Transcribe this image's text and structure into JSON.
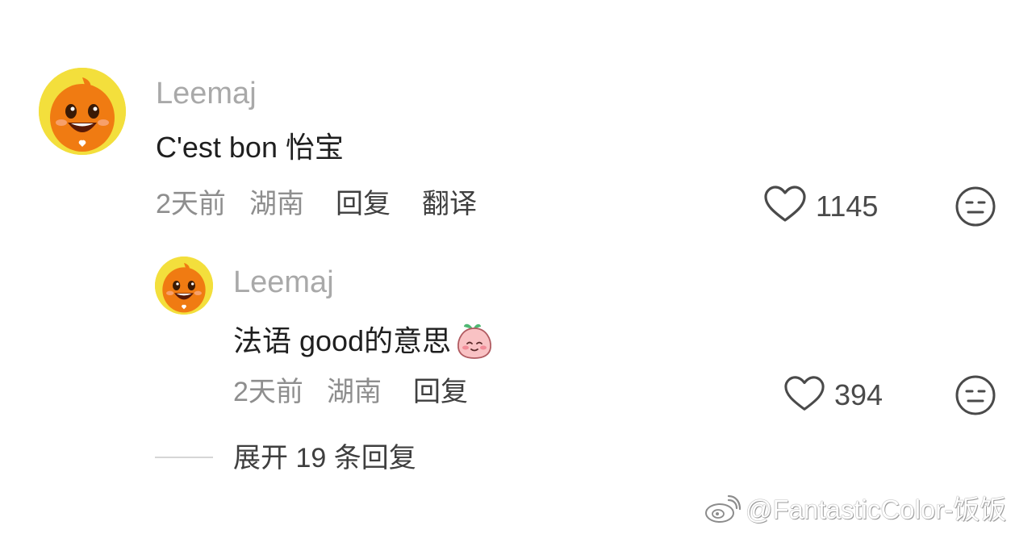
{
  "comment": {
    "username": "Leemaj",
    "text": "C'est bon 怡宝",
    "time": "2天前",
    "location": "湖南",
    "reply_label": "回复",
    "translate_label": "翻译",
    "like_count": "1145"
  },
  "reply": {
    "username": "Leemaj",
    "text": "法语 good的意思",
    "time": "2天前",
    "location": "湖南",
    "reply_label": "回复",
    "like_count": "394"
  },
  "expand": {
    "label": "展开 19 条回复"
  },
  "watermark": {
    "text": "@FantasticColor-饭饭"
  },
  "colors": {
    "avatar_background": "#f3df3c",
    "avatar_character": "#f07b12"
  }
}
